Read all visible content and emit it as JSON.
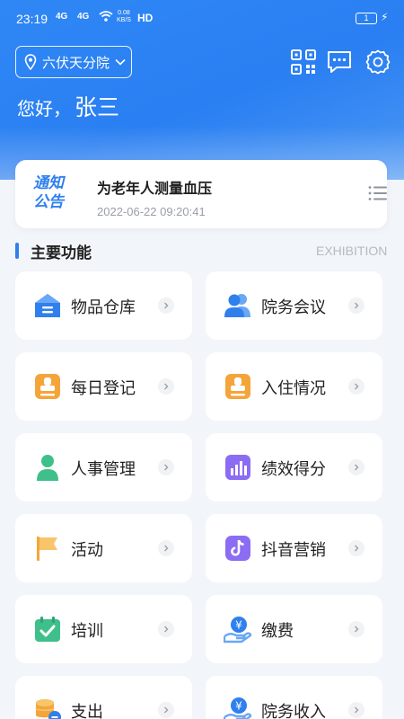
{
  "status_bar": {
    "time": "23:19",
    "signal_1": "4G",
    "signal_2": "4G",
    "net_speed_value": "0.08",
    "net_speed_unit": "KB/S",
    "hd": "HD",
    "battery": "1"
  },
  "header": {
    "location": "六伏天分院",
    "greeting": "您好，",
    "user_name": "张三",
    "icons": [
      "qr-code-icon",
      "message-icon",
      "gear-icon"
    ]
  },
  "notice": {
    "badge_line1": "通知",
    "badge_line2": "公告",
    "title": "为老年人测量血压",
    "time": "2022-06-22 09:20:41"
  },
  "section": {
    "title": "主要功能",
    "subtitle": "EXHIBITION"
  },
  "features": [
    {
      "label": "物品仓库",
      "icon": "warehouse-icon"
    },
    {
      "label": "院务会议",
      "icon": "meeting-icon"
    },
    {
      "label": "每日登记",
      "icon": "daily-register-icon"
    },
    {
      "label": "入住情况",
      "icon": "checkin-icon"
    },
    {
      "label": "人事管理",
      "icon": "personnel-icon"
    },
    {
      "label": "绩效得分",
      "icon": "performance-chart-icon"
    },
    {
      "label": "活动",
      "icon": "flag-icon"
    },
    {
      "label": "抖音营销",
      "icon": "tiktok-icon"
    },
    {
      "label": "培训",
      "icon": "training-check-icon"
    },
    {
      "label": "缴费",
      "icon": "payment-icon"
    },
    {
      "label": "支出",
      "icon": "expense-coins-icon"
    },
    {
      "label": "院务收入",
      "icon": "income-icon"
    }
  ],
  "colors": {
    "accent": "#2f80ed",
    "orange": "#f4a53a",
    "green": "#3fbf8a",
    "purple": "#8c6cf2",
    "background": "#f2f5f9"
  }
}
